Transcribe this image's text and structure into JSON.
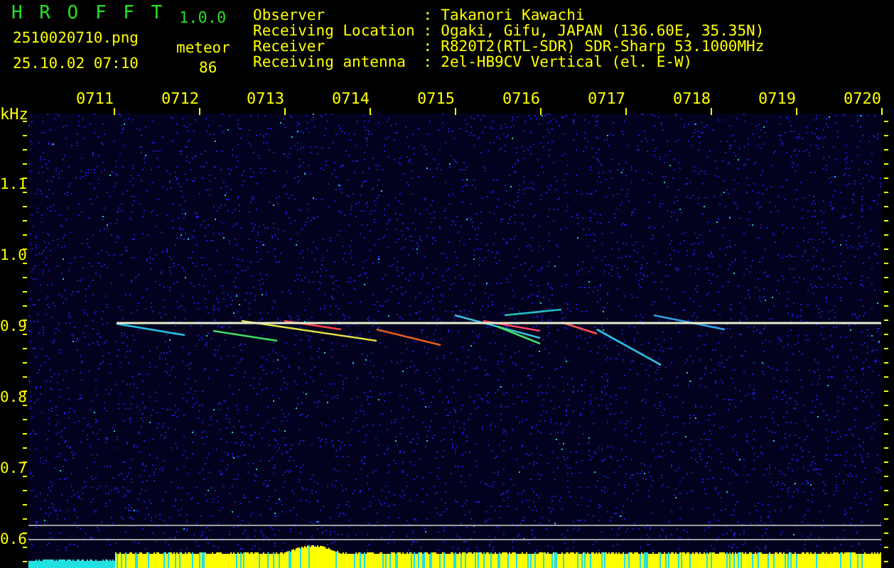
{
  "header": {
    "app_name": "H R O F F T",
    "version": "1.0.0",
    "filename": "2510020710.png",
    "timestamp": "25.10.02 07:10",
    "detection_label": "meteor",
    "detection_count": "86"
  },
  "station_info": [
    {
      "label": "Observer",
      "separator": ":",
      "value": "Takanori Kawachi"
    },
    {
      "label": "Receiving Location",
      "separator": ":",
      "value": "Ogaki, Gifu, JAPAN (136.60E, 35.35N)"
    },
    {
      "label": "Receiver",
      "separator": ":",
      "value": "R820T2(RTL-SDR) SDR-Sharp 53.1000MHz"
    },
    {
      "label": "Receiving antenna",
      "separator": ":",
      "value": "2el-HB9CV Vertical (el. E-W)"
    }
  ],
  "spectrogram": {
    "unit": "kHz",
    "time_labels": [
      "0711",
      "0712",
      "0713",
      "0714",
      "0715",
      "0716",
      "0717",
      "0718",
      "0719",
      "0720"
    ],
    "frequency_labels": [
      "1.1",
      "1.0",
      "0.9",
      "0.8",
      "0.7",
      "0.6"
    ]
  }
}
